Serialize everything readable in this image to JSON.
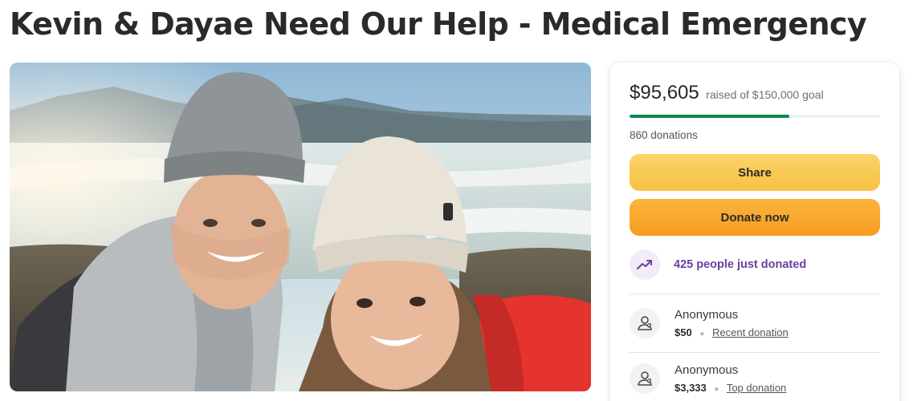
{
  "page": {
    "title": "Kevin & Dayae Need Our Help - Medical Emergency"
  },
  "hero_image": {
    "icon": "couple-selfie-photo"
  },
  "campaign": {
    "raised": "$95,605",
    "goal_text": "raised of $150,000 goal",
    "progress_fraction": 0.637,
    "donations_count": "860 donations",
    "share_label": "Share",
    "donate_label": "Donate now",
    "trend_text": "425 people just donated",
    "colors": {
      "progress": "#0c8a53",
      "share_button": "#f6c142",
      "donate_button": "#f59d20",
      "trend_text": "#6a3fa0"
    }
  },
  "donors": [
    {
      "name": "Anonymous",
      "amount": "$50",
      "tag": "Recent donation"
    },
    {
      "name": "Anonymous",
      "amount": "$3,333",
      "tag": "Top donation"
    }
  ]
}
